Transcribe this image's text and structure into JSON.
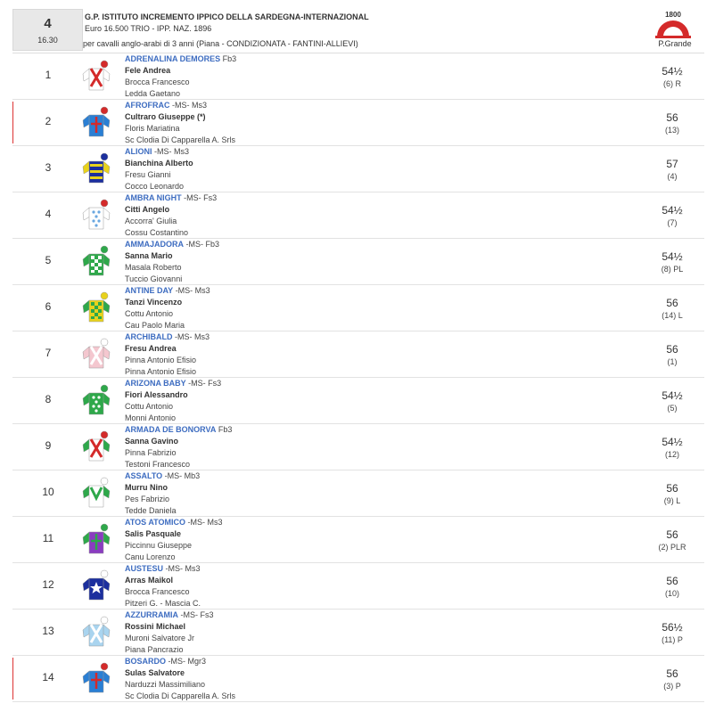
{
  "race": {
    "number": "4",
    "time": "16.30",
    "title": "G.P. ISTITUTO INCREMENTO IPPICO DELLA SARDEGNA-INTERNAZIONAL",
    "purse": "Euro 16.500 TRIO - IPP. NAZ. 1896",
    "conditions": "per cavalli anglo-arabi di 3 anni (Piana -  CONDIZIONATA  - FANTINI-ALLIEVI)",
    "track_logo_text": "1800",
    "track": "P.Grande"
  },
  "runners": [
    {
      "num": "1",
      "horse": "ADRENALINA DEMORES",
      "meta": " Fb3",
      "jockey": "Fele Andrea",
      "trainer": "Brocca Francesco",
      "owner": "Ledda Gaetano",
      "weight": "54½",
      "draw": "(6) R",
      "silk_colors": {
        "body": "#ffffff",
        "sleeve": "#ffffff",
        "pattern": "#d42a2a",
        "cap": "#d42a2a"
      },
      "silk_pattern": "cross",
      "silk_icon": "white-red-cross-silk-icon"
    },
    {
      "num": "2",
      "horse": "AFROFRAC",
      "meta": " -MS- Ms3",
      "jockey": "Cultraro Giuseppe (*)",
      "trainer": "Floris Mariatina",
      "owner": "Sc Clodia Di Capparella A. Srls",
      "weight": "56",
      "draw": "(13)",
      "silk_colors": {
        "body": "#2a7fd4",
        "sleeve": "#2a7fd4",
        "pattern": "#d42a2a",
        "cap": "#d42a2a"
      },
      "silk_pattern": "plus",
      "silk_icon": "blue-red-cross-silk-icon"
    },
    {
      "num": "3",
      "horse": "ALIONI",
      "meta": " -MS- Ms3",
      "jockey": "Bianchina Alberto",
      "trainer": "Fresu Gianni",
      "owner": "Cocco Leonardo",
      "weight": "57",
      "draw": "(4)",
      "silk_colors": {
        "body": "#1c2f9e",
        "sleeve": "#e8d21c",
        "pattern": "#e8d21c",
        "cap": "#1c2f9e"
      },
      "silk_pattern": "hoops",
      "silk_icon": "navy-yellow-hoops-silk-icon"
    },
    {
      "num": "4",
      "horse": "AMBRA NIGHT",
      "meta": " -MS- Fs3",
      "jockey": "Citti Angelo",
      "trainer": "Accorra' Giulia",
      "owner": "Cossu Costantino",
      "weight": "54½",
      "draw": "(7)",
      "silk_colors": {
        "body": "#ffffff",
        "sleeve": "#ffffff",
        "pattern": "#6aa7e0",
        "cap": "#d42a2a"
      },
      "silk_pattern": "spots",
      "silk_icon": "white-blue-spots-silk-icon"
    },
    {
      "num": "5",
      "horse": "AMMAJADORA",
      "meta": " -MS- Fb3",
      "jockey": "Sanna Mario",
      "trainer": "Masala Roberto",
      "owner": "Tuccio Giovanni",
      "weight": "54½",
      "draw": "(8) PL",
      "silk_colors": {
        "body": "#2ea84a",
        "sleeve": "#2ea84a",
        "pattern": "#ffffff",
        "cap": "#2ea84a"
      },
      "silk_pattern": "check",
      "silk_icon": "green-white-check-silk-icon"
    },
    {
      "num": "6",
      "horse": "ANTINE DAY",
      "meta": " -MS- Ms3",
      "jockey": "Tanzi Vincenzo",
      "trainer": "Cottu Antonio",
      "owner": "Cau Paolo Maria",
      "weight": "56",
      "draw": "(14) L",
      "silk_colors": {
        "body": "#e8d21c",
        "sleeve": "#2ea84a",
        "pattern": "#2ea84a",
        "cap": "#e8d21c"
      },
      "silk_pattern": "check",
      "silk_icon": "yellow-green-check-silk-icon"
    },
    {
      "num": "7",
      "horse": "ARCHIBALD",
      "meta": " -MS- Ms3",
      "jockey": "Fresu Andrea",
      "trainer": "Pinna Antonio Efisio",
      "owner": "Pinna Antonio Efisio",
      "weight": "56",
      "draw": "(1)",
      "silk_colors": {
        "body": "#f4c7cf",
        "sleeve": "#f4c7cf",
        "pattern": "#ffffff",
        "cap": "#ffffff"
      },
      "silk_pattern": "cross",
      "silk_icon": "pink-white-cross-silk-icon"
    },
    {
      "num": "8",
      "horse": "ARIZONA BABY",
      "meta": " -MS- Fs3",
      "jockey": "Fiori Alessandro",
      "trainer": "Cottu Antonio",
      "owner": "Monni Antonio",
      "weight": "54½",
      "draw": "(5)",
      "silk_colors": {
        "body": "#2ea84a",
        "sleeve": "#2ea84a",
        "pattern": "#ffffff",
        "cap": "#2ea84a"
      },
      "silk_pattern": "spots",
      "silk_icon": "green-white-spots-silk-icon"
    },
    {
      "num": "9",
      "horse": "ARMADA DE BONORVA",
      "meta": " Fb3",
      "jockey": "Sanna Gavino",
      "trainer": "Pinna Fabrizio",
      "owner": "Testoni Francesco",
      "weight": "54½",
      "draw": "(12)",
      "silk_colors": {
        "body": "#ffffff",
        "sleeve": "#2ea84a",
        "pattern": "#d42a2a",
        "cap": "#d42a2a"
      },
      "silk_pattern": "cross",
      "silk_icon": "white-red-cross-green-sleeves-silk-icon"
    },
    {
      "num": "10",
      "horse": "ASSALTO",
      "meta": " -MS- Mb3",
      "jockey": "Murru Nino",
      "trainer": "Pes Fabrizio",
      "owner": "Tedde Daniela",
      "weight": "56",
      "draw": "(9) L",
      "silk_colors": {
        "body": "#ffffff",
        "sleeve": "#2ea84a",
        "pattern": "#2ea84a",
        "cap": "#ffffff"
      },
      "silk_pattern": "chevron",
      "silk_icon": "white-green-chevron-silk-icon"
    },
    {
      "num": "11",
      "horse": "ATOS ATOMICO",
      "meta": " -MS- Ms3",
      "jockey": "Salis Pasquale",
      "trainer": "Piccinnu Giuseppe",
      "owner": "Canu Lorenzo",
      "weight": "56",
      "draw": "(2) PLR",
      "silk_colors": {
        "body": "#8a3cc0",
        "sleeve": "#2ea84a",
        "pattern": "#2ea84a",
        "cap": "#2ea84a"
      },
      "silk_pattern": "plus",
      "silk_icon": "purple-green-silk-icon"
    },
    {
      "num": "12",
      "horse": "AUSTESU",
      "meta": " -MS- Ms3",
      "jockey": "Arras Maikol",
      "trainer": "Brocca Francesco",
      "owner": "Pitzeri G. - Mascia C.",
      "weight": "56",
      "draw": "(10)",
      "silk_colors": {
        "body": "#1c2f9e",
        "sleeve": "#1c2f9e",
        "pattern": "#ffffff",
        "cap": "#ffffff"
      },
      "silk_pattern": "star",
      "silk_icon": "navy-white-star-silk-icon"
    },
    {
      "num": "13",
      "horse": "AZZURRAMIA",
      "meta": " -MS- Fs3",
      "jockey": "Rossini Michael",
      "trainer": "Muroni Salvatore Jr",
      "owner": "Piana Pancrazio",
      "weight": "56½",
      "draw": "(11) P",
      "silk_colors": {
        "body": "#a9d4ef",
        "sleeve": "#a9d4ef",
        "pattern": "#ffffff",
        "cap": "#ffffff"
      },
      "silk_pattern": "cross",
      "silk_icon": "lightblue-white-cross-silk-icon"
    },
    {
      "num": "14",
      "horse": "BOSARDO",
      "meta": " -MS- Mgr3",
      "jockey": "Sulas Salvatore",
      "trainer": "Narduzzi Massimiliano",
      "owner": "Sc Clodia Di Capparella A. Srls",
      "weight": "56",
      "draw": "(3) P",
      "silk_colors": {
        "body": "#2a7fd4",
        "sleeve": "#2a7fd4",
        "pattern": "#d42a2a",
        "cap": "#d42a2a"
      },
      "silk_pattern": "plus",
      "silk_icon": "blue-red-cross-silk-icon"
    }
  ]
}
